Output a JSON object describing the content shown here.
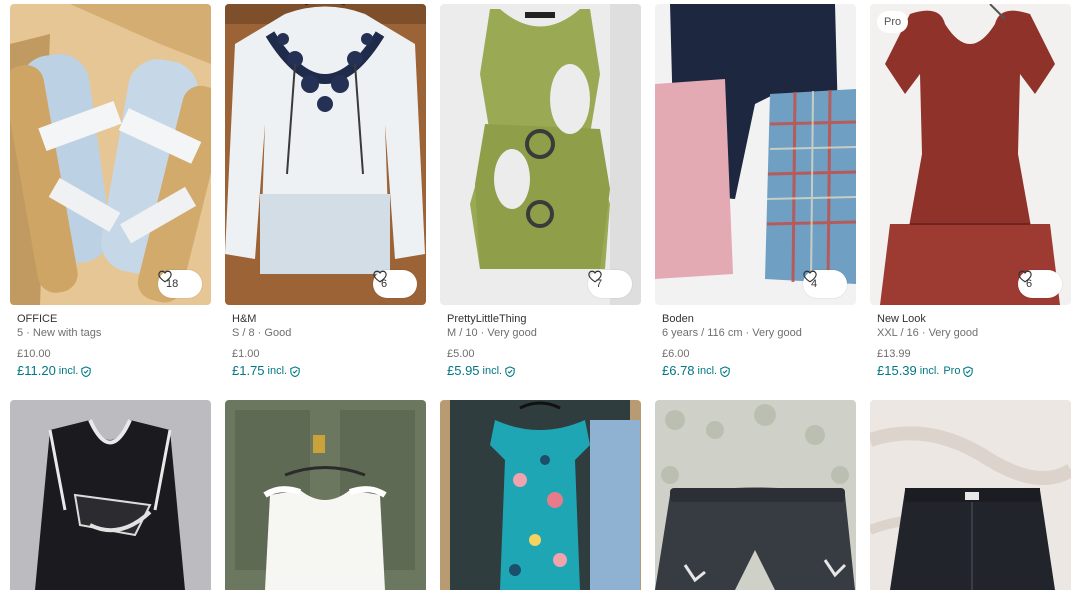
{
  "listings_row1": [
    {
      "brand": "OFFICE",
      "details": "5 · New with tags",
      "price": "£10.00",
      "total": "£11.20",
      "incl_label": "incl.",
      "favourites": "18",
      "pro": false,
      "photo_colors": [
        "#e9c99a",
        "#d9b781",
        "#b89563",
        "#9fb6c9"
      ]
    },
    {
      "brand": "H&M",
      "details": "S / 8 · Good",
      "price": "£1.00",
      "total": "£1.75",
      "incl_label": "incl.",
      "favourites": "6",
      "pro": false,
      "photo_colors": [
        "#a0683b",
        "#eef0f2",
        "#27334f",
        "#d5dee6"
      ]
    },
    {
      "brand": "PrettyLittleThing",
      "details": "M / 10 · Very good",
      "price": "£5.00",
      "total": "£5.95",
      "incl_label": "incl.",
      "favourites": "7",
      "pro": false,
      "photo_colors": [
        "#eeeeee",
        "#8e9f4a",
        "#a7b35f",
        "#3a3a3a"
      ]
    },
    {
      "brand": "Boden",
      "details": "6 years / 116 cm · Very good",
      "price": "£6.00",
      "total": "£6.78",
      "incl_label": "incl.",
      "favourites": "4",
      "pro": false,
      "photo_colors": [
        "#f3f3f3",
        "#1e2941",
        "#e0a8b0",
        "#7aa6c4"
      ]
    },
    {
      "brand": "New Look",
      "details": "XXL / 16 · Very good",
      "price": "£13.99",
      "total": "£15.39",
      "incl_label": "incl.",
      "favourites": "6",
      "pro": true,
      "pro_label": "Pro",
      "photo_colors": [
        "#f3f1ef",
        "#8a2f28",
        "#a5413a",
        "#6e251f"
      ]
    }
  ],
  "listings_row2": [
    {
      "photo_colors": [
        "#b9b9bd",
        "#1c1c20",
        "#e9e9ea",
        "#0f0f12"
      ]
    },
    {
      "photo_colors": [
        "#6e7b61",
        "#5a6651",
        "#f6f6f2",
        "#c9a23a"
      ]
    },
    {
      "photo_colors": [
        "#bfa07a",
        "#20a9b8",
        "#f1a7b0",
        "#2b3a3c"
      ]
    },
    {
      "photo_colors": [
        "#cfd1c8",
        "#9ea392",
        "#3a3e45",
        "#2e3137"
      ]
    },
    {
      "photo_colors": [
        "#efeae6",
        "#d9d2cb",
        "#23252c",
        "#1c1e24"
      ]
    }
  ],
  "icons": {
    "favourite": "heart-outline-icon",
    "buyer_protection": "shield-check-icon"
  },
  "accent_color": "#007782"
}
